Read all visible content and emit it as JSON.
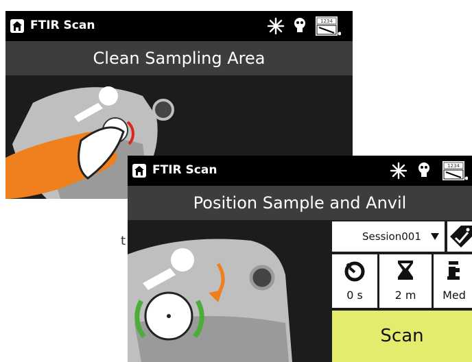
{
  "back_screen": {
    "app_title": "FTIR Scan",
    "instruction": "Clean Sampling Area",
    "battery_label": "1234"
  },
  "front_screen": {
    "app_title": "FTIR Scan",
    "instruction": "Position Sample and Anvil",
    "battery_label": "1234",
    "session": {
      "value": "Session001"
    },
    "stats": [
      {
        "icon": "timer-icon",
        "value": "0 s"
      },
      {
        "icon": "hourglass-icon",
        "value": "2 m"
      },
      {
        "icon": "pressure-icon",
        "value": "Med"
      }
    ],
    "scan_label": "Scan"
  },
  "edge_text": "t",
  "colors": {
    "status_bar": "#000000",
    "title_bar": "#3d3d3d",
    "background": "#1c1c1c",
    "scan_button": "#e4eb6d",
    "glove": "#f07f1e",
    "alignment_arc": "#4cae3a",
    "rotate_arrow": "#f07f1e",
    "clean_arc": "#d6281c"
  }
}
